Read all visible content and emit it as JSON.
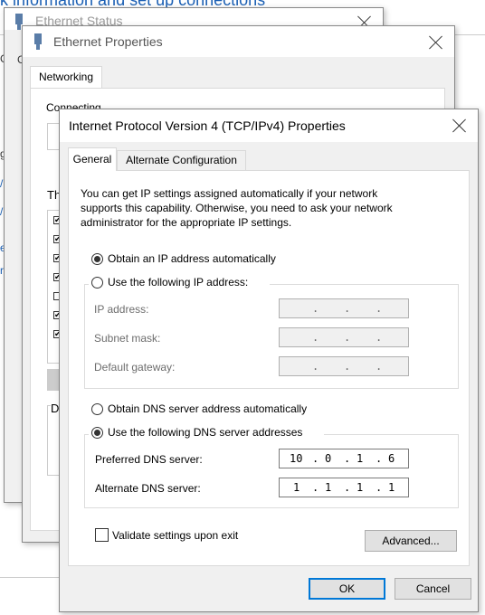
{
  "background": {
    "header_text": "k information and set up connections",
    "left_edge_chars": [
      "G",
      "g",
      "/",
      "/",
      "e",
      "r"
    ]
  },
  "status_window": {
    "title": "Ethernet Status"
  },
  "eth_props": {
    "title": "Ethernet Properties",
    "tab_networking": "Networking",
    "connect_using_partial": "Connecting",
    "this_connection_partial": "Th",
    "desc_partial": "D",
    "checklist": [
      {
        "checked": true
      },
      {
        "checked": true
      },
      {
        "checked": true
      },
      {
        "checked": true
      },
      {
        "checked": false
      },
      {
        "checked": true
      },
      {
        "checked": true
      }
    ]
  },
  "ipv4": {
    "title": "Internet Protocol Version 4 (TCP/IPv4) Properties",
    "tabs": {
      "general": "General",
      "alternate": "Alternate Configuration"
    },
    "intro_lines": [
      "You can get IP settings assigned automatically if your network",
      "supports this capability. Otherwise, you need to ask your network",
      "administrator for the appropriate IP settings."
    ],
    "obtain_ip_auto": "Obtain an IP address automatically",
    "use_following_ip": "Use the following IP address:",
    "ip_selected": "auto",
    "ip_address_label": "IP address:",
    "subnet_mask_label": "Subnet mask:",
    "default_gateway_label": "Default gateway:",
    "empty_ip": [
      ".",
      ".",
      "."
    ],
    "obtain_dns_auto": "Obtain DNS server address automatically",
    "use_following_dns": "Use the following DNS server addresses",
    "dns_selected": "manual",
    "preferred_dns_label": "Preferred DNS server:",
    "alternate_dns_label": "Alternate DNS server:",
    "preferred_dns": [
      "10",
      "0",
      "1",
      "6"
    ],
    "alternate_dns": [
      "1",
      "1",
      "1",
      "1"
    ],
    "validate_label": "Validate settings upon exit",
    "validate_checked": false,
    "advanced_button": "Advanced...",
    "ok_button": "OK",
    "cancel_button": "Cancel"
  },
  "colors": {
    "accent": "#0078d7",
    "link": "#1a5fb4"
  }
}
